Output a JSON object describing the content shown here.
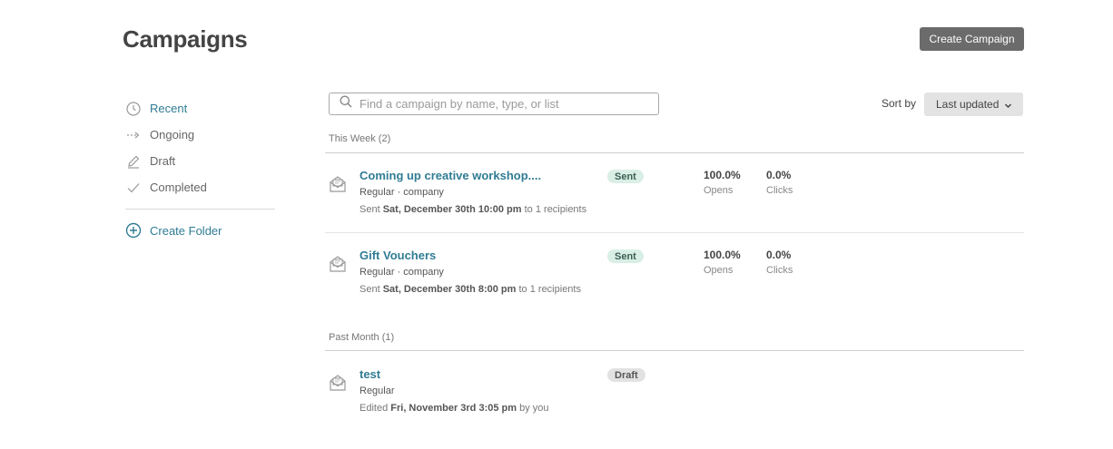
{
  "header": {
    "title": "Campaigns",
    "create_button": "Create Campaign"
  },
  "sidebar": {
    "items": [
      {
        "label": "Recent",
        "icon": "clock-icon",
        "active": true
      },
      {
        "label": "Ongoing",
        "icon": "dashed-arrow-icon",
        "active": false
      },
      {
        "label": "Draft",
        "icon": "pencil-icon",
        "active": false
      },
      {
        "label": "Completed",
        "icon": "checkmark-icon",
        "active": false
      }
    ],
    "create_folder": "Create Folder"
  },
  "search": {
    "placeholder": "Find a campaign by name, type, or list",
    "value": ""
  },
  "sort": {
    "label": "Sort by",
    "selected": "Last updated"
  },
  "groups": [
    {
      "header": "This Week (2)",
      "campaigns": [
        {
          "title": "Coming up creative workshop....",
          "type": "Regular · company",
          "meta_prefix": "Sent",
          "meta_date": "Sat, December 30th 10:00 pm",
          "meta_suffix": "to 1 recipients",
          "status": "Sent",
          "opens": "100.0%",
          "opens_label": "Opens",
          "clicks": "0.0%",
          "clicks_label": "Clicks"
        },
        {
          "title": "Gift Vouchers",
          "type": "Regular · company",
          "meta_prefix": "Sent",
          "meta_date": "Sat, December 30th 8:00 pm",
          "meta_suffix": "to 1 recipients",
          "status": "Sent",
          "opens": "100.0%",
          "opens_label": "Opens",
          "clicks": "0.0%",
          "clicks_label": "Clicks"
        }
      ]
    },
    {
      "header": "Past Month (1)",
      "campaigns": [
        {
          "title": "test",
          "type": "Regular",
          "meta_prefix": "Edited",
          "meta_date": "Fri, November 3rd 3:05 pm",
          "meta_suffix": "by you",
          "status": "Draft"
        }
      ]
    }
  ],
  "colors": {
    "accent": "#307c94",
    "sent_badge": "#d9efe6",
    "draft_badge": "#e2e2e2",
    "button": "#6b6b6b"
  }
}
